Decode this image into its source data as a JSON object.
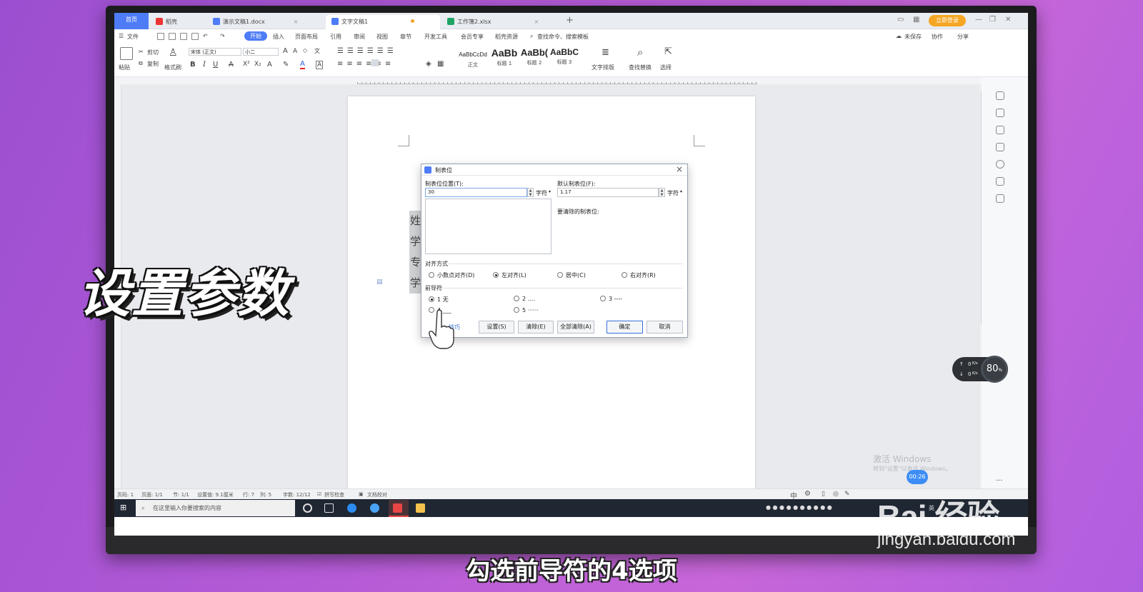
{
  "tabs": [
    {
      "label": "首页"
    },
    {
      "label": "稻壳"
    },
    {
      "label": "演示文稿1.docx"
    },
    {
      "label": "文字文稿1"
    },
    {
      "label": "工作簿2.xlsx"
    }
  ],
  "login_label": "立即登录",
  "menu": {
    "file": "文件",
    "items": [
      "开始",
      "插入",
      "页面布局",
      "引用",
      "审阅",
      "视图",
      "章节",
      "开发工具",
      "会员专享",
      "稻壳资源"
    ],
    "search": "查找命令、搜索模板",
    "unsaved": "未保存",
    "collab": "协作",
    "share": "分享"
  },
  "ribbon": {
    "paste": "粘贴",
    "cut": "剪切",
    "copy": "复制",
    "format_painter": "格式刷",
    "font": "宋体 (正文)",
    "size": "小二",
    "styles": [
      {
        "preview": "AaBbCcDd",
        "label": "正文"
      },
      {
        "preview": "AaBb",
        "label": "标题 1"
      },
      {
        "preview": "AaBb(",
        "label": "标题 2"
      },
      {
        "preview": "AaBbC",
        "label": "标题 3"
      }
    ],
    "text_layout": "文字排版",
    "find_replace": "查找替换",
    "select": "选择"
  },
  "document": {
    "chars": [
      "姓",
      "学",
      "专",
      "学"
    ]
  },
  "dialog": {
    "title": "制表位",
    "tab_pos_label": "制表位位置(T):",
    "tab_pos_value": "30",
    "unit": "字符",
    "default_label": "默认制表位(F):",
    "default_value": "1.17",
    "clear_label": "要清除的制表位:",
    "align_label": "对齐方式",
    "align_options": [
      "小数点对齐(D)",
      "左对齐(L)",
      "居中(C)",
      "右对齐(R)"
    ],
    "align_selected": "左对齐(L)",
    "leader_label": "前导符",
    "leader_options": [
      "1 无",
      "2 ....",
      "3 ----",
      "4 ___",
      "5 ······"
    ],
    "leader_selected": "1 无",
    "link_fragment": "技巧",
    "buttons": {
      "set": "设置(S)",
      "clear": "清除(E)",
      "clear_all": "全部清除(A)",
      "ok": "确定",
      "cancel": "取消"
    }
  },
  "status": {
    "page": "页码: 1",
    "pages": "页面: 1/1",
    "section": "节: 1/1",
    "setting": "设置值: 9.1厘米",
    "row": "行: 7",
    "col": "列: 5",
    "words": "字数: 12/12",
    "spell": "拼写检查",
    "proof": "文档校对"
  },
  "taskbar": {
    "search_placeholder": "在这里输入你要搜索的内容",
    "ime": "中",
    "lang": "英"
  },
  "gauge": {
    "percent": "80",
    "percent_unit": "%",
    "up": "0",
    "down": "0",
    "rate_unit": "K/s"
  },
  "activation": {
    "line1": "激活 Windows",
    "line2": "转到\"设置\"以激活 Windows。"
  },
  "timer": "00:26",
  "overlay": {
    "title": "设置参数",
    "subtitle": "勾选前导符的4选项",
    "logo": "Bai 经验",
    "url": "jingyan.baidu.com"
  },
  "colors": {
    "accent": "#4e7cf6",
    "primary_border": "#2c6ad8",
    "login": "#f5a623"
  }
}
